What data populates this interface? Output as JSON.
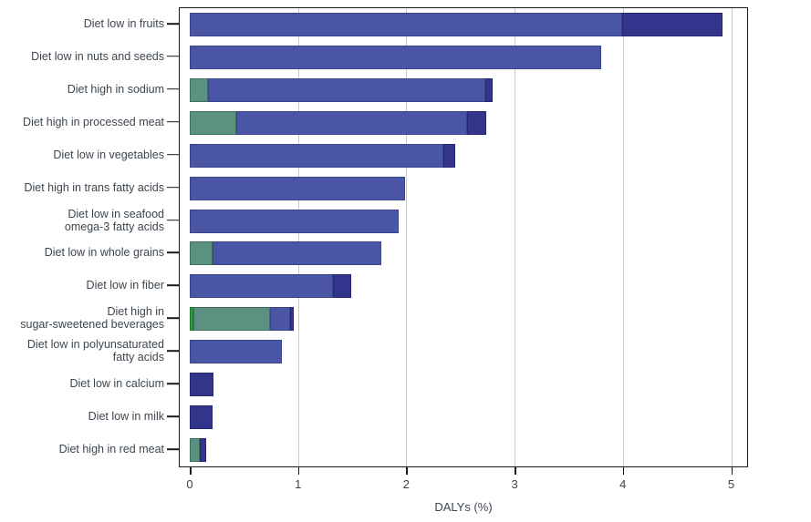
{
  "chart_data": {
    "type": "bar",
    "orientation": "horizontal",
    "stacked": true,
    "title": "",
    "subtitle": "",
    "xlabel": "DALYs (%)",
    "ylabel": "",
    "xlim": [
      0,
      5.08
    ],
    "xticks": [
      0,
      1,
      2,
      3,
      4,
      5
    ],
    "xticklabels": [
      "0",
      "1",
      "2",
      "3",
      "4",
      "5"
    ],
    "grid": "vertical",
    "legend": "none",
    "categories": [
      "Diet low in fruits",
      "Diet low in nuts and seeds",
      "Diet high in sodium",
      "Diet high in processed meat",
      "Diet low in vegetables",
      "Diet high in trans fatty acids",
      "Diet low in seafood\nomega-3 fatty acids",
      "Diet low in whole grains",
      "Diet low in fiber",
      "Diet high in\nsugar-sweetened beverages",
      "Diet low in polyunsaturated\nfatty acids",
      "Diet low in calcium",
      "Diet low in milk",
      "Diet high in red meat"
    ],
    "series": [
      {
        "name": "green",
        "color": "#5a9181",
        "values": [
          0,
          0,
          0.17,
          0.43,
          0,
          0,
          0,
          0.21,
          0,
          0.71,
          0,
          0,
          0,
          0.09
        ]
      },
      {
        "name": "bright-green",
        "color": "#2e9c3a",
        "values": [
          0,
          0,
          0,
          0,
          0,
          0,
          0,
          0,
          0,
          0.03,
          0,
          0,
          0,
          0
        ]
      },
      {
        "name": "blue",
        "color": "#4a56a5",
        "values": [
          3.99,
          3.8,
          2.56,
          1.98,
          2.34,
          1.99,
          1.93,
          1.56,
          1.32,
          0.19,
          0.85,
          0,
          0,
          0
        ]
      },
      {
        "name": "dark-blue",
        "color": "#33348c",
        "values": [
          0.93,
          0,
          0.07,
          0.18,
          0.11,
          0,
          0,
          0,
          0.17,
          0.03,
          0,
          0.22,
          0.21,
          0.06
        ]
      }
    ],
    "totals": [
      4.92,
      3.8,
      2.8,
      2.74,
      2.45,
      1.99,
      1.93,
      1.77,
      1.49,
      0.96,
      0.85,
      0.22,
      0.21,
      0.15
    ],
    "stack_order": [
      "bright-green",
      "green",
      "blue",
      "dark-blue"
    ],
    "bar_stacks": [
      [
        {
          "s": "blue",
          "v": 3.99
        },
        {
          "s": "dark-blue",
          "v": 0.93
        }
      ],
      [
        {
          "s": "blue",
          "v": 3.8
        }
      ],
      [
        {
          "s": "green",
          "v": 0.17
        },
        {
          "s": "blue",
          "v": 2.56
        },
        {
          "s": "dark-blue",
          "v": 0.07
        }
      ],
      [
        {
          "s": "green",
          "v": 0.43
        },
        {
          "s": "blue",
          "v": 2.13
        },
        {
          "s": "dark-blue",
          "v": 0.18
        }
      ],
      [
        {
          "s": "blue",
          "v": 2.34
        },
        {
          "s": "dark-blue",
          "v": 0.11
        }
      ],
      [
        {
          "s": "blue",
          "v": 1.99
        }
      ],
      [
        {
          "s": "blue",
          "v": 1.93
        }
      ],
      [
        {
          "s": "green",
          "v": 0.21
        },
        {
          "s": "blue",
          "v": 1.56
        }
      ],
      [
        {
          "s": "blue",
          "v": 1.32
        },
        {
          "s": "dark-blue",
          "v": 0.17
        }
      ],
      [
        {
          "s": "bright-green",
          "v": 0.03
        },
        {
          "s": "green",
          "v": 0.71
        },
        {
          "s": "blue",
          "v": 0.19
        },
        {
          "s": "dark-blue",
          "v": 0.03
        }
      ],
      [
        {
          "s": "blue",
          "v": 0.85
        }
      ],
      [
        {
          "s": "dark-blue",
          "v": 0.22
        }
      ],
      [
        {
          "s": "dark-blue",
          "v": 0.21
        }
      ],
      [
        {
          "s": "green",
          "v": 0.09
        },
        {
          "s": "dark-blue",
          "v": 0.06
        }
      ]
    ]
  },
  "colors": {
    "green": "#5a9181",
    "bright_green": "#2e9c3a",
    "blue": "#4a56a5",
    "dark_blue": "#33348c",
    "gridline": "#c9c9c9",
    "axis": "#1a1a1a",
    "text": "#3d4650",
    "background": "#ffffff"
  }
}
